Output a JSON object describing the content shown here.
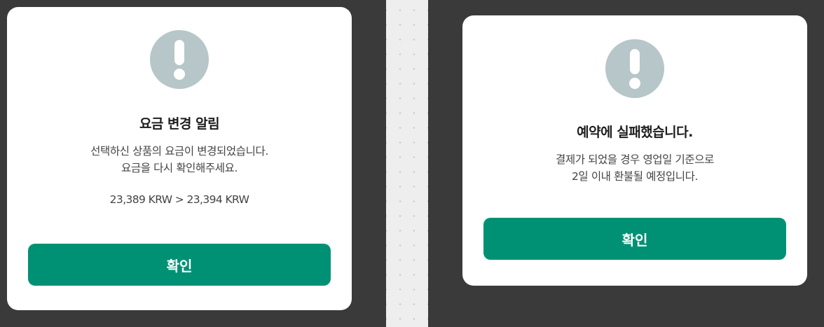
{
  "dialogs": [
    {
      "title": "요금 변경 알림",
      "message_lines": [
        "선택하신 상품의 요금이 변경되었습니다.",
        "요금을 다시 확인해주세요."
      ],
      "price_change": "23,389 KRW > 23,394 KRW",
      "confirm_label": "확인",
      "icon": "exclamation-circle-icon"
    },
    {
      "title": "예약에 실패했습니다.",
      "message_lines": [
        "결제가 되었을 경우 영업일 기준으로",
        "2일 이내 환불될 예정입니다."
      ],
      "confirm_label": "확인",
      "icon": "exclamation-circle-icon"
    }
  ],
  "colors": {
    "background": "#3a3a3a",
    "dialog": "#ffffff",
    "icon": "#b6c6c9",
    "button": "#009175",
    "divider": "#eeeeee"
  }
}
